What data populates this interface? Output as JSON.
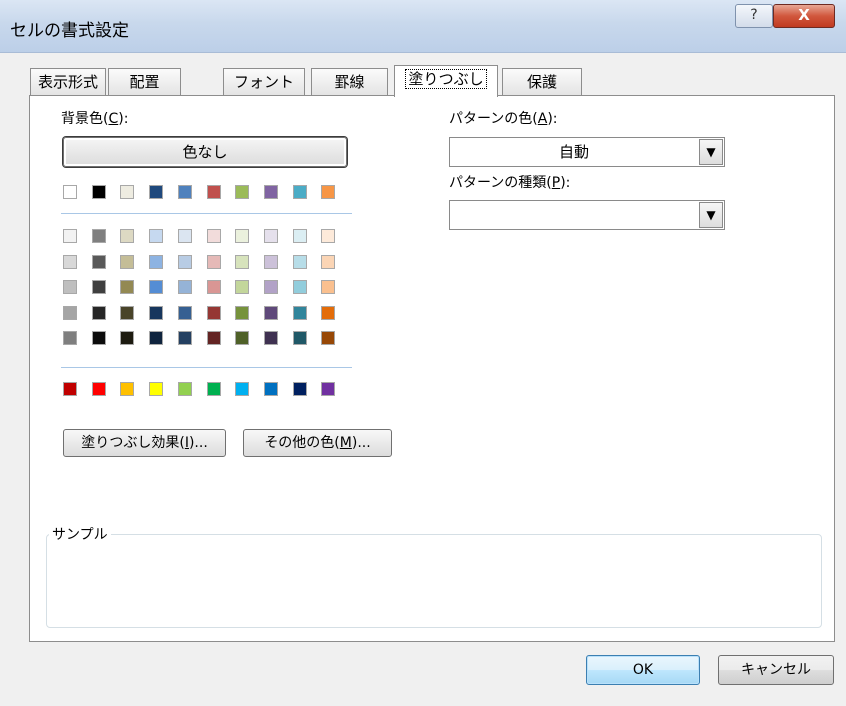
{
  "window": {
    "title": "セルの書式設定",
    "help_label": "?",
    "close_label": "X"
  },
  "tabs": [
    {
      "label": "表示形式"
    },
    {
      "label": "配置"
    },
    {
      "label": "フォント"
    },
    {
      "label": "罫線"
    },
    {
      "label": "塗りつぶし",
      "selected": true
    },
    {
      "label": "保護"
    }
  ],
  "background_color": {
    "label": "背景色(",
    "mnemonic": "C",
    "label_suffix": "):",
    "no_color_button": "色なし",
    "theme_top_row": [
      "#ffffff",
      "#000000",
      "#eeece1",
      "#1f497d",
      "#4f81bd",
      "#c0504d",
      "#9bbb59",
      "#8064a2",
      "#4bacc6",
      "#f79646"
    ],
    "theme_tint_rows": [
      [
        "#f2f2f2",
        "#7f7f7f",
        "#ddd9c3",
        "#c6d9f0",
        "#dbe5f1",
        "#f2dcdb",
        "#ebf1dd",
        "#e5e0ec",
        "#dbeef3",
        "#fdeada"
      ],
      [
        "#d8d8d8",
        "#595959",
        "#c4bd97",
        "#8db3e2",
        "#b8cce4",
        "#e5b9b7",
        "#d7e3bc",
        "#ccc1d9",
        "#b7dde8",
        "#fbd5b5"
      ],
      [
        "#bfbfbf",
        "#3f3f3f",
        "#938953",
        "#548dd4",
        "#95b3d7",
        "#d99694",
        "#c3d69b",
        "#b2a2c7",
        "#92cddc",
        "#fac08f"
      ],
      [
        "#a5a5a5",
        "#262626",
        "#494429",
        "#17365d",
        "#366092",
        "#953734",
        "#76923c",
        "#5f497a",
        "#31859b",
        "#e36c09"
      ],
      [
        "#7f7f7f",
        "#0c0c0c",
        "#1d1b10",
        "#0f243e",
        "#244061",
        "#632423",
        "#4f6128",
        "#3f3151",
        "#205867",
        "#974806"
      ]
    ],
    "standard_row": [
      "#c00000",
      "#ff0000",
      "#ffc000",
      "#ffff00",
      "#92d050",
      "#00b050",
      "#00b0f0",
      "#0070c0",
      "#002060",
      "#7030a0"
    ],
    "fill_effects_button": {
      "label": "塗りつぶし効果(",
      "mnemonic": "I",
      "suffix": ")..."
    },
    "more_colors_button": {
      "label": "その他の色(",
      "mnemonic": "M",
      "suffix": ")..."
    }
  },
  "pattern_color": {
    "label": "パターンの色(",
    "mnemonic": "A",
    "suffix": "):",
    "value": "自動"
  },
  "pattern_style": {
    "label": "パターンの種類(",
    "mnemonic": "P",
    "suffix": "):",
    "value": ""
  },
  "sample": {
    "label": "サンプル"
  },
  "buttons": {
    "ok": "OK",
    "cancel": "キャンセル"
  }
}
